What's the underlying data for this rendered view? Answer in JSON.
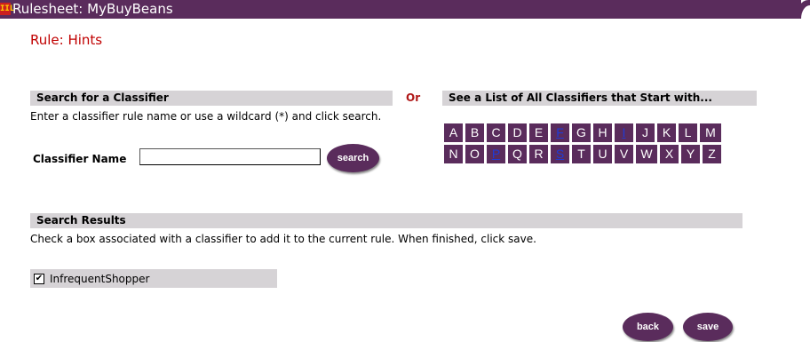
{
  "topbar": {
    "logo": "IIL",
    "title": "Rulesheet: MyBuyBeans"
  },
  "page": {
    "title": "Rule: Hints"
  },
  "search_section": {
    "header": "Search for a Classifier",
    "instructions": "Enter a classifier rule name or use a wildcard (*) and click search.",
    "field_label": "Classifier Name",
    "field_value": "",
    "search_button": "search"
  },
  "or_label": "Or",
  "list_section": {
    "header": "See a List of All Classifiers that Start with...",
    "rows": [
      [
        {
          "letter": "A",
          "linked": false
        },
        {
          "letter": "B",
          "linked": false
        },
        {
          "letter": "C",
          "linked": false
        },
        {
          "letter": "D",
          "linked": false
        },
        {
          "letter": "E",
          "linked": false
        },
        {
          "letter": "F",
          "linked": true
        },
        {
          "letter": "G",
          "linked": false
        },
        {
          "letter": "H",
          "linked": false
        },
        {
          "letter": "I",
          "linked": true
        },
        {
          "letter": "J",
          "linked": false
        },
        {
          "letter": "K",
          "linked": false
        },
        {
          "letter": "L",
          "linked": false
        },
        {
          "letter": "M",
          "linked": false
        }
      ],
      [
        {
          "letter": "N",
          "linked": false
        },
        {
          "letter": "O",
          "linked": false
        },
        {
          "letter": "P",
          "linked": true
        },
        {
          "letter": "Q",
          "linked": false
        },
        {
          "letter": "R",
          "linked": false
        },
        {
          "letter": "S",
          "linked": true
        },
        {
          "letter": "T",
          "linked": false
        },
        {
          "letter": "U",
          "linked": false
        },
        {
          "letter": "V",
          "linked": false
        },
        {
          "letter": "W",
          "linked": false
        },
        {
          "letter": "X",
          "linked": false
        },
        {
          "letter": "Y",
          "linked": false
        },
        {
          "letter": "Z",
          "linked": false
        }
      ]
    ]
  },
  "results_section": {
    "header": "Search Results",
    "instructions": "Check a box associated with a classifier to add it to the current rule. When finished, click save.",
    "items": [
      {
        "label": "InfrequentShopper",
        "checked": true,
        "check_glyph": "✔"
      }
    ]
  },
  "actions": {
    "back": "back",
    "save": "save"
  },
  "colors": {
    "brand": "#5a2c5c",
    "accent_red": "#c00000",
    "section_gray": "#d6d3d6",
    "link_blue": "#1f3bd6"
  }
}
